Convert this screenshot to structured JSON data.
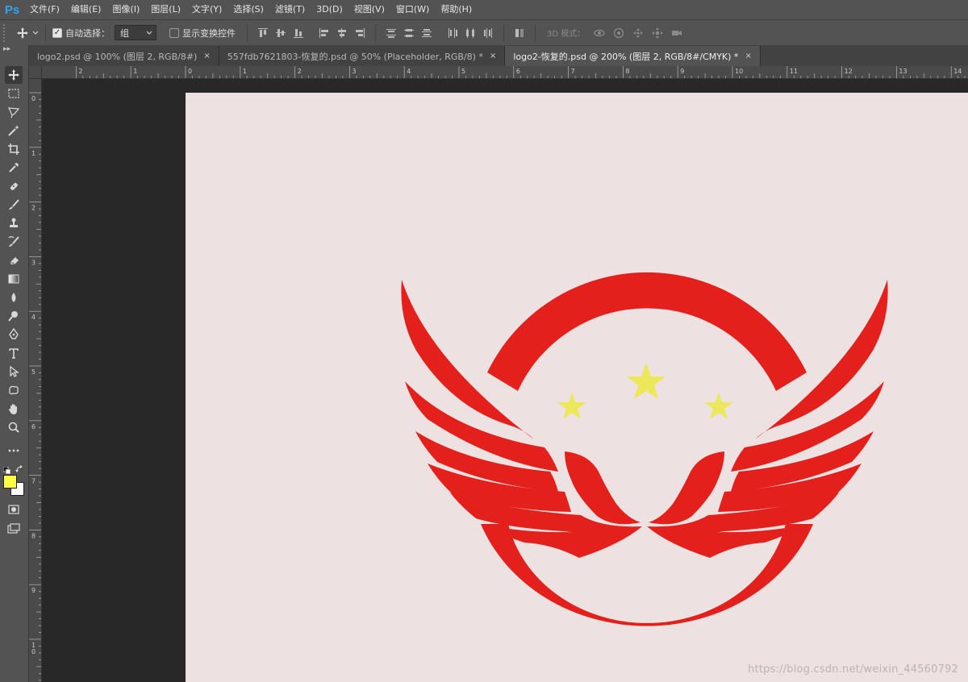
{
  "app": {
    "logo": "Ps"
  },
  "menu": [
    "文件(F)",
    "编辑(E)",
    "图像(I)",
    "图层(L)",
    "文字(Y)",
    "选择(S)",
    "滤镜(T)",
    "3D(D)",
    "视图(V)",
    "窗口(W)",
    "帮助(H)"
  ],
  "options": {
    "auto_select_label": "自动选择：",
    "auto_select_checked": true,
    "auto_select_value": "组",
    "show_transform_label": "显示变换控件",
    "show_transform_checked": false,
    "mode3d_label": "3D 模式："
  },
  "tabs": [
    {
      "label": "logo2.psd @ 100% (图层 2, RGB/8#)",
      "close": "×",
      "active": false
    },
    {
      "label": "557fdb7621803-恢复的.psd @ 50% (Placeholder, RGB/8) *",
      "close": "×",
      "active": false
    },
    {
      "label": "logo2-恢复的.psd @ 200% (图层 2, RGB/8#/CMYK) *",
      "close": "×",
      "active": true
    }
  ],
  "ruler_top_labels": [
    "2",
    "1",
    "0",
    "1",
    "2",
    "3",
    "4",
    "5",
    "6",
    "7",
    "8",
    "9",
    "10",
    "11",
    "12",
    "13",
    "14"
  ],
  "ruler_left_labels": [
    "0",
    "1",
    "2",
    "3",
    "4",
    "5",
    "6",
    "7",
    "8",
    "9",
    "10"
  ],
  "tools": [
    "move-tool",
    "marquee-tool",
    "lasso-tool",
    "magic-wand-tool",
    "crop-tool",
    "eyedropper-tool",
    "healing-brush-tool",
    "brush-tool",
    "clone-stamp-tool",
    "history-brush-tool",
    "eraser-tool",
    "gradient-tool",
    "blur-tool",
    "dodge-tool",
    "pen-tool",
    "type-tool",
    "path-selection-tool",
    "shape-tool",
    "hand-tool",
    "zoom-tool",
    "more-tools"
  ],
  "colors": {
    "foreground": "#ffff44",
    "background": "#ffffff",
    "canvas": "#ede1e1",
    "logo_red": "#e3201b",
    "star_yellow": "#ede85a"
  },
  "watermark": "https://blog.csdn.net/weixin_44560792"
}
